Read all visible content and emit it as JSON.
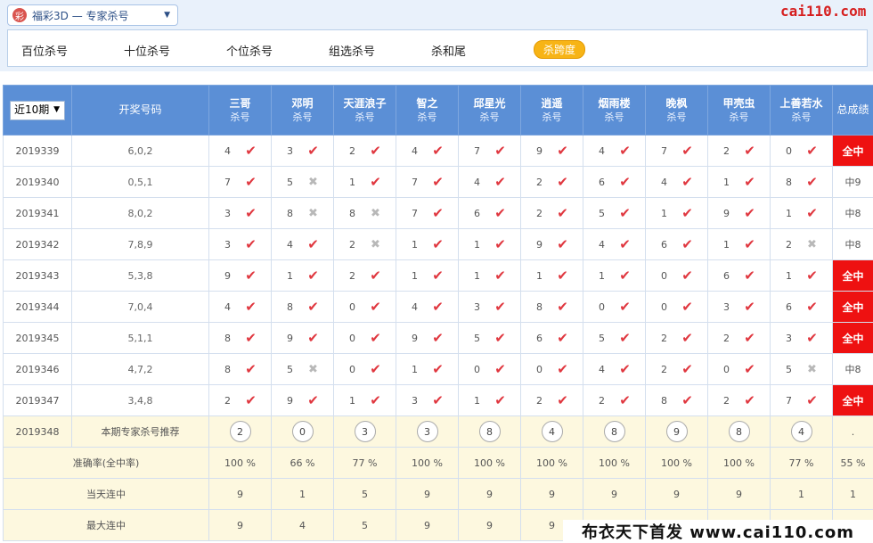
{
  "header": {
    "lottery_select": "福彩3D — 专家杀号",
    "logo_glyph": "彩",
    "brand": "cai110.com"
  },
  "tabs": [
    "百位杀号",
    "十位杀号",
    "个位杀号",
    "组选杀号",
    "杀和尾",
    "杀跨度"
  ],
  "active_tab_index": 5,
  "table": {
    "period_select": "近10期",
    "draw_header": "开奖号码",
    "total_header": "总成绩",
    "experts": [
      "三哥",
      "邓明",
      "天涯浪子",
      "智之",
      "邱星光",
      "逍遥",
      "烟雨楼",
      "晚枫",
      "甲壳虫",
      "上善若水"
    ],
    "sub_label": "杀号",
    "rows": [
      {
        "period": "2019339",
        "draw": "6,0,2",
        "picks": [
          [
            4,
            1
          ],
          [
            3,
            1
          ],
          [
            2,
            1
          ],
          [
            4,
            1
          ],
          [
            7,
            1
          ],
          [
            9,
            1
          ],
          [
            4,
            1
          ],
          [
            7,
            1
          ],
          [
            2,
            1
          ],
          [
            0,
            1
          ]
        ],
        "total": "全中",
        "all": true
      },
      {
        "period": "2019340",
        "draw": "0,5,1",
        "picks": [
          [
            7,
            1
          ],
          [
            5,
            0
          ],
          [
            1,
            1
          ],
          [
            7,
            1
          ],
          [
            4,
            1
          ],
          [
            2,
            1
          ],
          [
            6,
            1
          ],
          [
            4,
            1
          ],
          [
            1,
            1
          ],
          [
            8,
            1
          ]
        ],
        "total": "中9",
        "all": false
      },
      {
        "period": "2019341",
        "draw": "8,0,2",
        "picks": [
          [
            3,
            1
          ],
          [
            8,
            0
          ],
          [
            8,
            0
          ],
          [
            7,
            1
          ],
          [
            6,
            1
          ],
          [
            2,
            1
          ],
          [
            5,
            1
          ],
          [
            1,
            1
          ],
          [
            9,
            1
          ],
          [
            1,
            1
          ]
        ],
        "total": "中8",
        "all": false
      },
      {
        "period": "2019342",
        "draw": "7,8,9",
        "picks": [
          [
            3,
            1
          ],
          [
            4,
            1
          ],
          [
            2,
            0
          ],
          [
            1,
            1
          ],
          [
            1,
            1
          ],
          [
            9,
            1
          ],
          [
            4,
            1
          ],
          [
            6,
            1
          ],
          [
            1,
            1
          ],
          [
            2,
            0
          ]
        ],
        "total": "中8",
        "all": false
      },
      {
        "period": "2019343",
        "draw": "5,3,8",
        "picks": [
          [
            9,
            1
          ],
          [
            1,
            1
          ],
          [
            2,
            1
          ],
          [
            1,
            1
          ],
          [
            1,
            1
          ],
          [
            1,
            1
          ],
          [
            1,
            1
          ],
          [
            0,
            1
          ],
          [
            6,
            1
          ],
          [
            1,
            1
          ]
        ],
        "total": "全中",
        "all": true
      },
      {
        "period": "2019344",
        "draw": "7,0,4",
        "picks": [
          [
            4,
            1
          ],
          [
            8,
            1
          ],
          [
            0,
            1
          ],
          [
            4,
            1
          ],
          [
            3,
            1
          ],
          [
            8,
            1
          ],
          [
            0,
            1
          ],
          [
            0,
            1
          ],
          [
            3,
            1
          ],
          [
            6,
            1
          ]
        ],
        "total": "全中",
        "all": true
      },
      {
        "period": "2019345",
        "draw": "5,1,1",
        "picks": [
          [
            8,
            1
          ],
          [
            9,
            1
          ],
          [
            0,
            1
          ],
          [
            9,
            1
          ],
          [
            5,
            1
          ],
          [
            6,
            1
          ],
          [
            5,
            1
          ],
          [
            2,
            1
          ],
          [
            2,
            1
          ],
          [
            3,
            1
          ]
        ],
        "total": "全中",
        "all": true
      },
      {
        "period": "2019346",
        "draw": "4,7,2",
        "picks": [
          [
            8,
            1
          ],
          [
            5,
            0
          ],
          [
            0,
            1
          ],
          [
            1,
            1
          ],
          [
            0,
            1
          ],
          [
            0,
            1
          ],
          [
            4,
            1
          ],
          [
            2,
            1
          ],
          [
            0,
            1
          ],
          [
            5,
            0
          ]
        ],
        "total": "中8",
        "all": false
      },
      {
        "period": "2019347",
        "draw": "3,4,8",
        "picks": [
          [
            2,
            1
          ],
          [
            9,
            1
          ],
          [
            1,
            1
          ],
          [
            3,
            1
          ],
          [
            1,
            1
          ],
          [
            2,
            1
          ],
          [
            2,
            1
          ],
          [
            8,
            1
          ],
          [
            2,
            1
          ],
          [
            7,
            1
          ]
        ],
        "total": "全中",
        "all": true
      }
    ],
    "recommend": {
      "period": "2019348",
      "label": "本期专家杀号推荐",
      "values": [
        "2",
        "0",
        "3",
        "3",
        "8",
        "4",
        "8",
        "9",
        "8",
        "4"
      ],
      "total": "."
    },
    "rate": {
      "label": "准确率(全中率)",
      "values": [
        "100 %",
        "66 %",
        "77 %",
        "100 %",
        "100 %",
        "100 %",
        "100 %",
        "100 %",
        "100 %",
        "77 %"
      ],
      "total": "55 %"
    },
    "today_streak": {
      "label": "当天连中",
      "values": [
        "9",
        "1",
        "5",
        "9",
        "9",
        "9",
        "9",
        "9",
        "9",
        "1"
      ],
      "total": "1"
    },
    "max_streak": {
      "label": "最大连中",
      "values": [
        "9",
        "4",
        "5",
        "9",
        "9",
        "9",
        "",
        "",
        "",
        ""
      ],
      "total": ""
    }
  },
  "watermark": "布衣天下首发 www.cai110.com"
}
